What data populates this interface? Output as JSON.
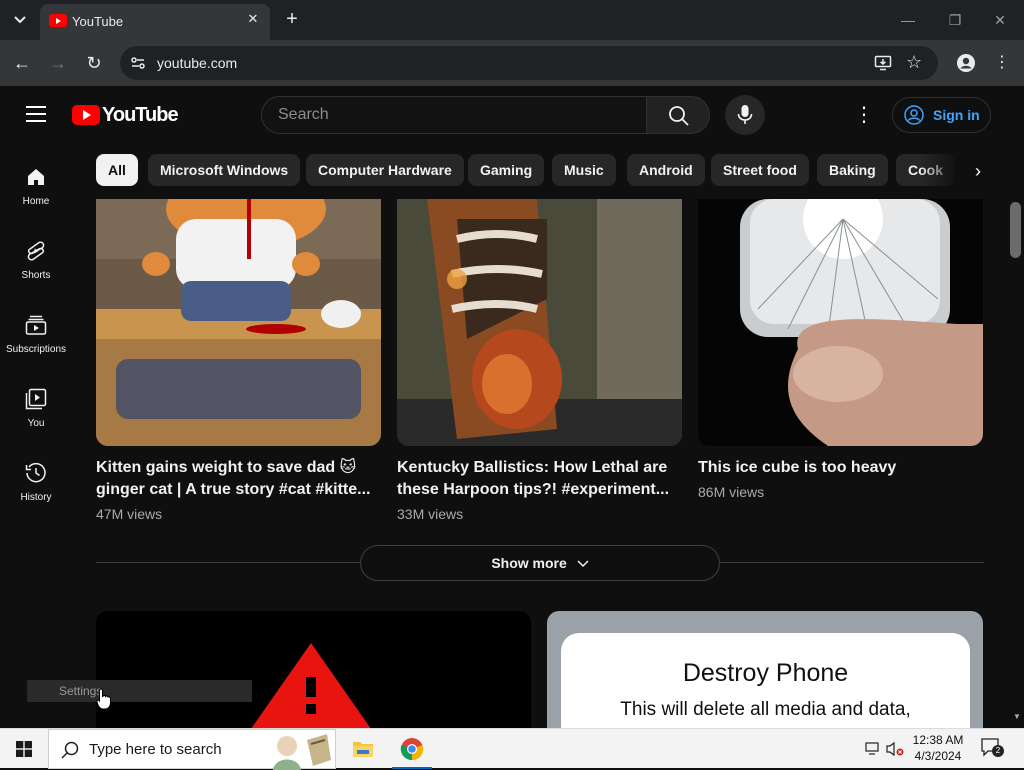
{
  "browser": {
    "tab_title": "YouTube",
    "url": "youtube.com"
  },
  "youtube": {
    "logo_text": "YouTube",
    "search_placeholder": "Search",
    "sign_in_label": "Sign in",
    "chips": [
      "All",
      "Microsoft Windows",
      "Computer Hardware",
      "Gaming",
      "Music",
      "Android",
      "Street food",
      "Baking",
      "Cook"
    ],
    "nav": [
      {
        "label": "Home",
        "icon": "home-icon"
      },
      {
        "label": "Shorts",
        "icon": "shorts-icon"
      },
      {
        "label": "Subscriptions",
        "icon": "subscriptions-icon"
      },
      {
        "label": "You",
        "icon": "you-icon"
      },
      {
        "label": "History",
        "icon": "history-icon"
      }
    ],
    "shorts": [
      {
        "title": "Kitten gains weight to save dad 🐱 ginger cat | A true story #cat #kitte...",
        "views": "47M views"
      },
      {
        "title": "Kentucky Ballistics: How Lethal are these Harpoon tips?! #experiment...",
        "views": "33M views"
      },
      {
        "title": "This ice cube is too heavy",
        "views": "86M views"
      }
    ],
    "show_more_label": "Show more",
    "phone_card": {
      "heading": "Destroy Phone",
      "body": "This will delete all media and data,"
    },
    "tooltip": "Settings"
  },
  "taskbar": {
    "search_placeholder": "Type here to search",
    "time": "12:38 AM",
    "date": "4/3/2024",
    "notifications": "2"
  },
  "colors": {
    "background": "#0f0f0f",
    "brand_red": "#ff0000",
    "link_blue": "#3ea6ff"
  }
}
